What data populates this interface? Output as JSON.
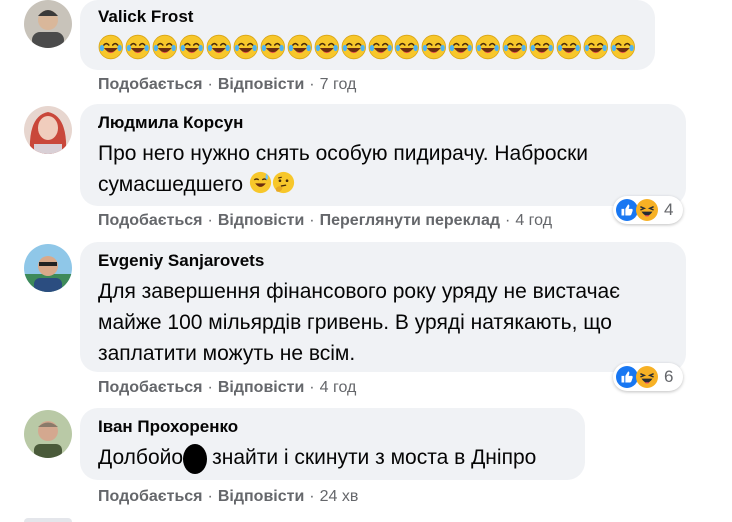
{
  "actions": {
    "like": "Подобається",
    "reply": "Відповісти",
    "translate": "Переглянути переклад",
    "separator": "·"
  },
  "comments": [
    {
      "author": "Valick Frost",
      "text": "",
      "emoji_count": 20,
      "time": "7 год"
    },
    {
      "author": "Людмила Корсун",
      "text_line1": "Про него нужно снять особую пидирачу. Наброски",
      "text_line2": "сумасшедшего",
      "time": "4 год",
      "reaction_count": "4"
    },
    {
      "author": "Evgeniy Sanjarovets",
      "text_line1": "Для завершення фінансового року уряду не вистачає",
      "text_line2": "майже 100 мільярдів гривень. В уряді натякають, що",
      "text_line3": "заплатити можуть не всім.",
      "time": "4 год",
      "reaction_count": "6"
    },
    {
      "author": "Іван Прохоренко",
      "text": "Долбойоба знайти і скинути з моста в Дніпро",
      "time": "24 хв"
    }
  ],
  "colors": {
    "bubble": "#f0f2f5",
    "meta": "#65676b",
    "like_blue": "#1877f2",
    "haha_yellow": "#f7b125"
  },
  "icons": [
    "laughing-emoji-icon",
    "sweat-smile-emoji-icon",
    "thinking-emoji-icon",
    "like-reaction-icon",
    "haha-reaction-icon"
  ]
}
